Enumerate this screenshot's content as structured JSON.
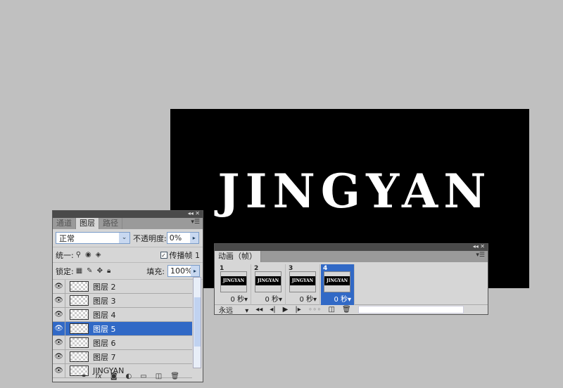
{
  "canvas": {
    "text": "JINGYAN"
  },
  "layers_panel": {
    "tabs": [
      "通道",
      "图层",
      "路径"
    ],
    "active_tab": 1,
    "blend_mode": "正常",
    "opacity_label": "不透明度:",
    "opacity": "0%",
    "unify_label": "统一:",
    "propagate_label": "传播帧 1",
    "propagate_checked": true,
    "lock_label": "锁定:",
    "fill_label": "填充:",
    "fill": "100%",
    "layers": [
      {
        "name": "图层 2",
        "visible": true
      },
      {
        "name": "图层 3",
        "visible": true
      },
      {
        "name": "图层 4",
        "visible": true
      },
      {
        "name": "图层 5",
        "visible": true,
        "selected": true
      },
      {
        "name": "图层 6",
        "visible": true
      },
      {
        "name": "图层 7",
        "visible": true
      },
      {
        "name": "JINGYAN",
        "visible": true
      }
    ]
  },
  "animation_panel": {
    "title": "动画（帧）",
    "frames": [
      {
        "number": "1",
        "delay": "0 秒▾",
        "thumb": "JINGYAN"
      },
      {
        "number": "2",
        "delay": "0 秒▾",
        "thumb": "JINGYAN"
      },
      {
        "number": "3",
        "delay": "0 秒▾",
        "thumb": "JINGYAN"
      },
      {
        "number": "4",
        "delay": "0 秒▾",
        "thumb": "JINGYAN",
        "selected": true
      }
    ],
    "loop": "永远"
  },
  "colors": {
    "selection": "#3169c6",
    "canvas": "#000000",
    "background": "#c0c0c0"
  }
}
